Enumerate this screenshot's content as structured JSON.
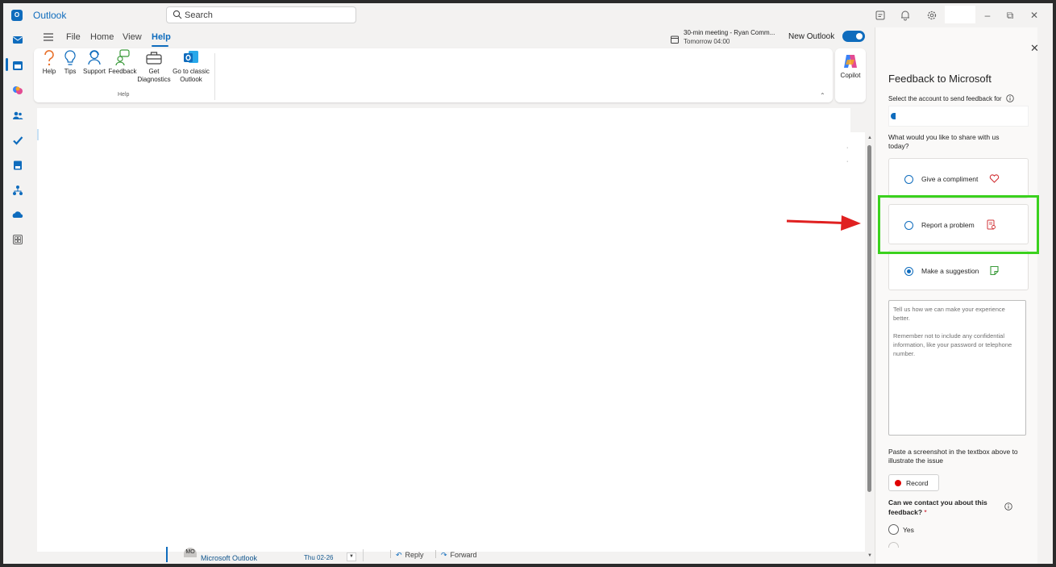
{
  "app": {
    "name": "Outlook"
  },
  "search": {
    "placeholder": "Search"
  },
  "nav": {
    "tabs": [
      {
        "label": "File"
      },
      {
        "label": "Home"
      },
      {
        "label": "View"
      },
      {
        "label": "Help"
      }
    ],
    "active_tab": "Help"
  },
  "meeting": {
    "title": "30-min meeting - Ryan Comm...",
    "time": "Tomorrow 04:00"
  },
  "new_outlook": {
    "label": "New Outlook",
    "enabled": true
  },
  "ribbon": {
    "items": [
      {
        "label": "Help",
        "icon": "question-icon"
      },
      {
        "label": "Tips",
        "icon": "lightbulb-icon"
      },
      {
        "label": "Support",
        "icon": "person-support-icon"
      },
      {
        "label": "Feedback",
        "icon": "feedback-icon"
      },
      {
        "label": "Get Diagnostics",
        "icon": "toolbox-icon"
      },
      {
        "label": "Go to classic Outlook",
        "icon": "outlook-icon"
      }
    ],
    "group_label": "Help"
  },
  "copilot": {
    "label": "Copilot"
  },
  "mail_row": {
    "avatar": "MO",
    "sender": "Microsoft Outlook",
    "date": "Thu 02-26",
    "reply": "Reply",
    "forward": "Forward"
  },
  "feedback": {
    "title": "Feedback to Microsoft",
    "account_label": "Select the account to send feedback for",
    "share_question": "What would you like to share with us today?",
    "options": [
      {
        "label": "Give a compliment",
        "icon": "heart-icon",
        "checked": false
      },
      {
        "label": "Report a problem",
        "icon": "bug-report-icon",
        "checked": false
      },
      {
        "label": "Make a suggestion",
        "icon": "suggestion-icon",
        "checked": true
      }
    ],
    "textarea_placeholder": "Tell us how we can make your experience better.\n\nRemember not to include any confidential information, like your password or telephone number.",
    "paste_hint": "Paste a screenshot in the textbox above to illustrate the issue",
    "record_label": "Record",
    "contact_question": "Can we contact you about this feedback?",
    "required_mark": "*",
    "yes_label": "Yes"
  },
  "colors": {
    "accent": "#0f6cbd",
    "highlight": "#3bd11e",
    "arrow": "#e02020",
    "record": "#e00000"
  }
}
